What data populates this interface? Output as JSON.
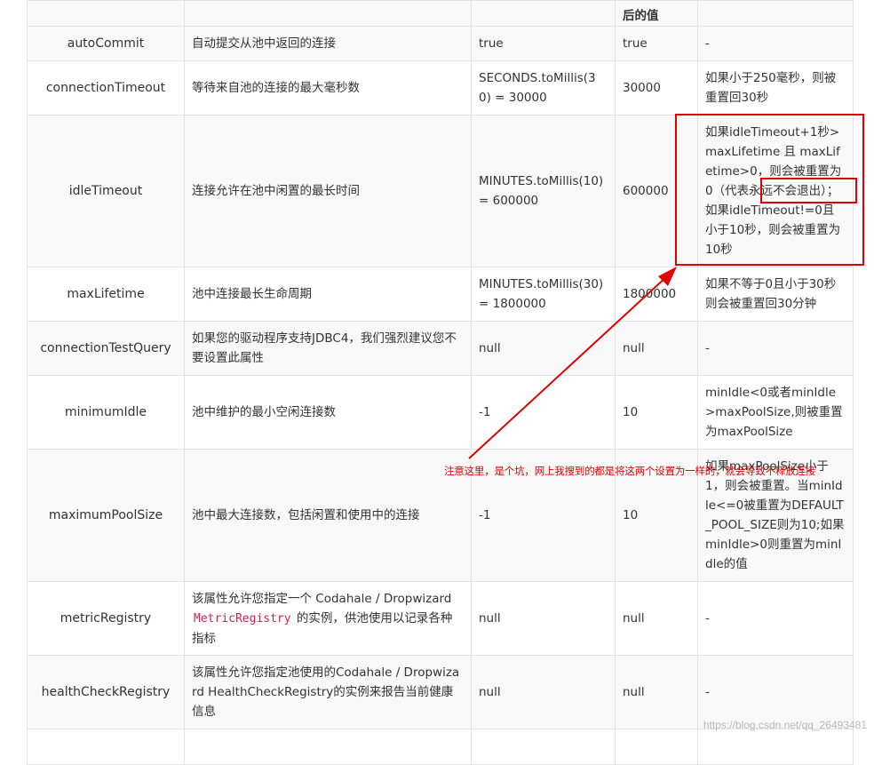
{
  "header": {
    "col4_tail": "后的值"
  },
  "rows": [
    {
      "name": "autoCommit",
      "desc": "自动提交从池中返回的连接",
      "default": "true",
      "value": "true",
      "note": "-"
    },
    {
      "name": "connectionTimeout",
      "desc": "等待来自池的连接的最大毫秒数",
      "default": "SECONDS.toMillis(30) = 30000",
      "value": "30000",
      "note": "如果小于250毫秒，则被重置回30秒"
    },
    {
      "name": "idleTimeout",
      "desc": "连接允许在池中闲置的最长时间",
      "default": "MINUTES.toMillis(10) = 600000",
      "value": "600000",
      "note": "如果idleTimeout+1秒>maxLifetime 且 maxLifetime>0，则会被重置为0（代表永远不会退出）；如果idleTimeout!=0且小于10秒，则会被重置为10秒"
    },
    {
      "name": "maxLifetime",
      "desc": "池中连接最长生命周期",
      "default": "MINUTES.toMillis(30) = 1800000",
      "value": "1800000",
      "note": "如果不等于0且小于30秒则会被重置回30分钟"
    },
    {
      "name": "connectionTestQuery",
      "desc": "如果您的驱动程序支持JDBC4，我们强烈建议您不要设置此属性",
      "default": "null",
      "value": "null",
      "note": "-"
    },
    {
      "name": "minimumIdle",
      "desc": "池中维护的最小空闲连接数",
      "default": "-1",
      "value": "10",
      "note": "minIdle<0或者minIdle>maxPoolSize,则被重置为maxPoolSize"
    },
    {
      "name": "maximumPoolSize",
      "desc": "池中最大连接数，包括闲置和使用中的连接",
      "default": "-1",
      "value": "10",
      "note": "如果maxPoolSize小于1，则会被重置。当minIdle<=0被重置为DEFAULT_POOL_SIZE则为10;如果minIdle>0则重置为minIdle的值"
    },
    {
      "name": "metricRegistry",
      "desc_pre": "该属性允许您指定一个 Codahale / Dropwizard ",
      "desc_code": "MetricRegistry",
      "desc_post": " 的实例，供池使用以记录各种指标",
      "default": "null",
      "value": "null",
      "note": "-"
    },
    {
      "name": "healthCheckRegistry",
      "desc": "该属性允许您指定池使用的Codahale / Dropwizard HealthCheckRegistry的实例来报告当前健康信息",
      "default": "null",
      "value": "null",
      "note": "-"
    }
  ],
  "annotation": {
    "text": "注意这里，是个坑，网上我搜到的都是将这两个设置为一样的，就会导致不释放连接",
    "color": "#e00000"
  },
  "watermark": "https://blog.csdn.net/qq_26493481"
}
